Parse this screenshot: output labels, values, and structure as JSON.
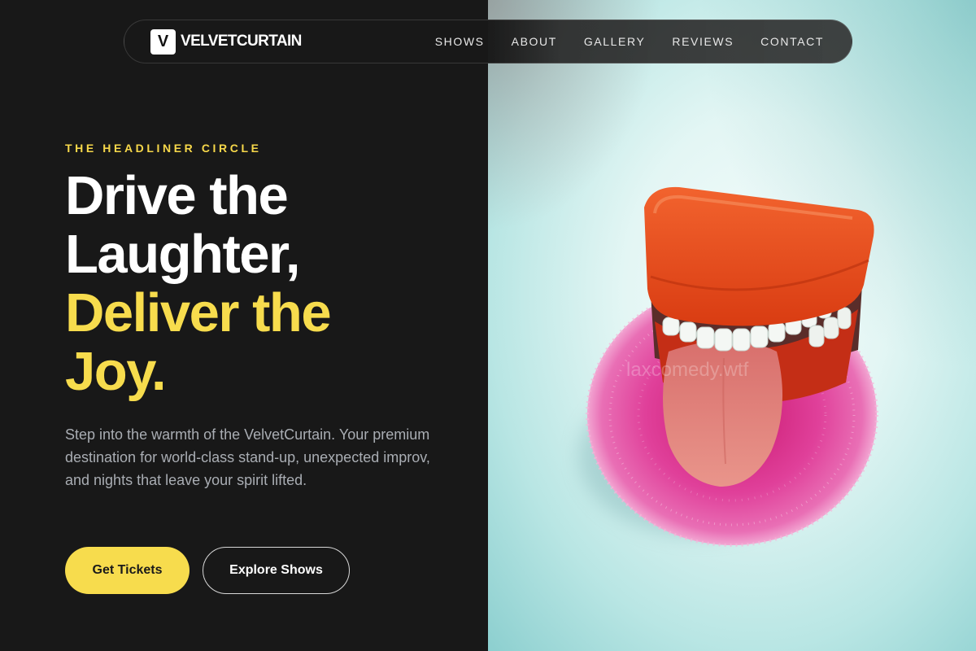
{
  "brand": {
    "mark": "V",
    "name": "VELVETCURTAIN"
  },
  "nav": {
    "links": [
      "SHOWS",
      "ABOUT",
      "GALLERY",
      "REVIEWS",
      "CONTACT"
    ]
  },
  "hero": {
    "eyebrow": "THE HEADLINER CIRCLE",
    "headline_lines": [
      "Drive the",
      "Laughter,",
      "Deliver the",
      "Joy."
    ],
    "description": "Step into the warmth of the VelvetCurtain. Your premium destination for world-class stand-up, unexpected improv, and nights that leave your spirit lifted.",
    "primary_cta": "Get Tickets",
    "secondary_cta": "Explore Shows",
    "image_subject": "wind-up chattering teeth toy on pink pad",
    "image_watermark": "laxcomedy.wtf"
  },
  "colors": {
    "background": "#181818",
    "accent": "#f7dc4d",
    "text_primary": "#ffffff",
    "text_muted": "#a9adb3"
  }
}
